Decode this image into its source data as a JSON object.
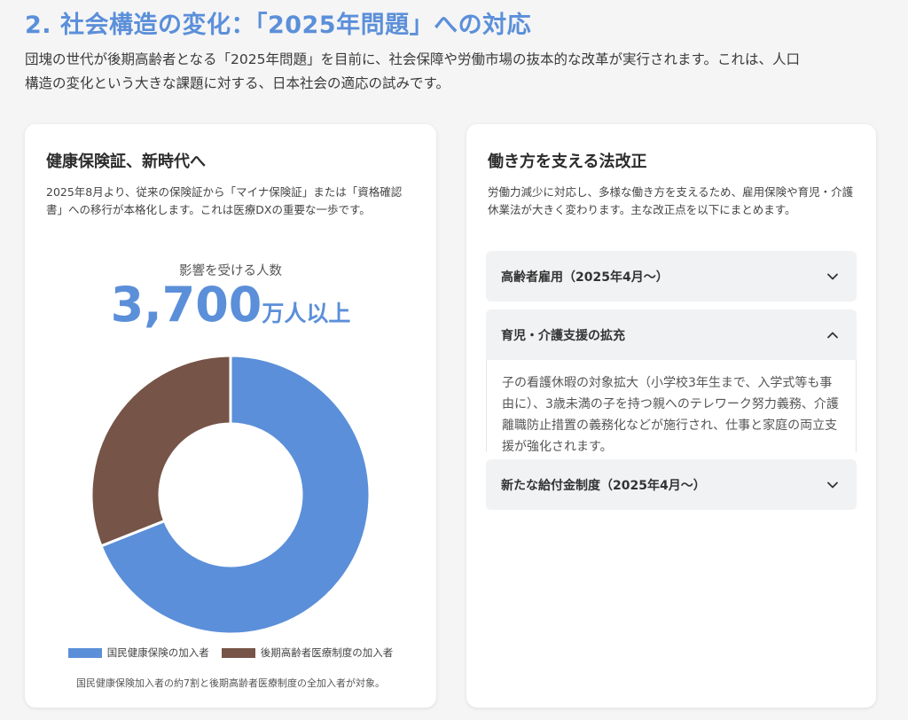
{
  "page": {
    "title": "2. 社会構造の変化：「2025年問題」への対応",
    "intro": "団塊の世代が後期高齢者となる「2025年問題」を目前に、社会保障や労働市場の抜本的な改革が実行されます。これは、人口構造の変化という大きな課題に対する、日本社会の適応の試みです。"
  },
  "left_card": {
    "title": "健康保険証、新時代へ",
    "description": "2025年8月より、従来の保険証から「マイナ保険証」または「資格確認書」への移行が本格化します。これは医療DXの重要な一歩です。",
    "stat_label": "影響を受ける人数",
    "stat_value": "3,700",
    "stat_unit": "万人以上",
    "footnote": "国民健康保険加入者の約7割と後期高齢者医療制度の全加入者が対象。"
  },
  "chart_data": {
    "type": "pie",
    "donut": true,
    "categories": [
      "国民健康保険の加入者",
      "後期高齢者医療制度の加入者"
    ],
    "values": [
      69,
      31
    ],
    "colors": [
      "#5b8fd9",
      "#765447"
    ],
    "legend": "bottom"
  },
  "right_card": {
    "title": "働き方を支える法改正",
    "description": "労働力減少に対応し、多様な働き方を支えるため、雇用保険や育児・介護休業法が大きく変わります。主な改正点を以下にまとめます。",
    "accordion": [
      {
        "label": "高齢者雇用（2025年4月〜）",
        "expanded": false
      },
      {
        "label": "育児・介護支援の拡充",
        "expanded": true,
        "body": "子の看護休暇の対象拡大（小学校3年生まで、入学式等も事由に）、3歳未満の子を持つ親へのテレワーク努力義務、介護離職防止措置の義務化などが施行され、仕事と家庭の両立支援が強化されます。"
      },
      {
        "label": "新たな給付金制度（2025年4月〜）",
        "expanded": false
      }
    ]
  },
  "icons": {
    "collapsed": "chevron-down-icon",
    "expanded": "chevron-up-icon"
  }
}
